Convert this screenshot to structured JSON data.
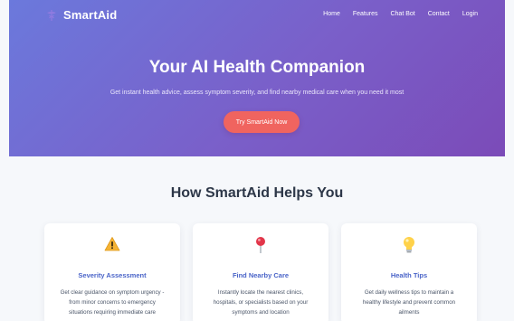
{
  "brand": {
    "name": "SmartAid",
    "icon": "caduceus-icon"
  },
  "nav": [
    "Home",
    "Features",
    "Chat Bot",
    "Contact",
    "Login"
  ],
  "hero": {
    "title": "Your AI Health Companion",
    "subtitle": "Get instant health advice, assess symptom severity, and find nearby medical care when you need it most",
    "cta": "Try SmartAid Now"
  },
  "section": {
    "title": "How SmartAid Helps You"
  },
  "cards": [
    {
      "icon": "warning-icon",
      "title": "Severity Assessment",
      "desc1": "Get clear guidance on symptom urgency -",
      "desc2": "from minor concerns to emergency",
      "desc3": "situations requiring immediate care"
    },
    {
      "icon": "map-pin-icon",
      "title": "Find Nearby Care",
      "desc1": "Instantly locate the nearest clinics,",
      "desc2": "hospitals, or specialists based on your",
      "desc3": "symptoms and location"
    },
    {
      "icon": "lightbulb-icon",
      "title": "Health Tips",
      "desc1": "Get daily wellness tips to maintain a",
      "desc2": "healthy lifestyle and prevent common",
      "desc3": "ailments"
    }
  ],
  "colors": {
    "hero_gradient_start": "#6b79dc",
    "hero_gradient_end": "#7b4bb8",
    "cta": "#f0645f",
    "card_title": "#4a64c8",
    "heading": "#2d3748"
  }
}
